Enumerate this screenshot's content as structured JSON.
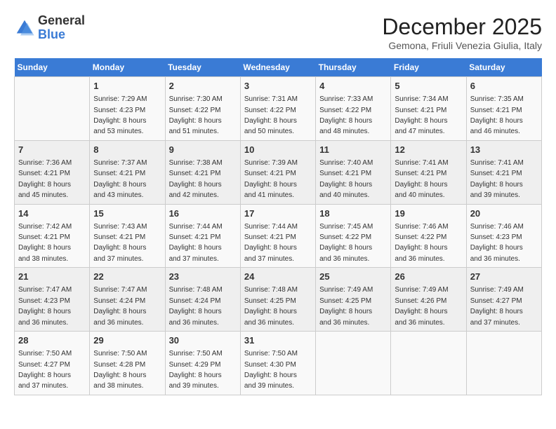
{
  "header": {
    "logo_general": "General",
    "logo_blue": "Blue",
    "month_title": "December 2025",
    "location": "Gemona, Friuli Venezia Giulia, Italy"
  },
  "days_of_week": [
    "Sunday",
    "Monday",
    "Tuesday",
    "Wednesday",
    "Thursday",
    "Friday",
    "Saturday"
  ],
  "weeks": [
    [
      {
        "day": "",
        "info": ""
      },
      {
        "day": "1",
        "info": "Sunrise: 7:29 AM\nSunset: 4:23 PM\nDaylight: 8 hours\nand 53 minutes."
      },
      {
        "day": "2",
        "info": "Sunrise: 7:30 AM\nSunset: 4:22 PM\nDaylight: 8 hours\nand 51 minutes."
      },
      {
        "day": "3",
        "info": "Sunrise: 7:31 AM\nSunset: 4:22 PM\nDaylight: 8 hours\nand 50 minutes."
      },
      {
        "day": "4",
        "info": "Sunrise: 7:33 AM\nSunset: 4:22 PM\nDaylight: 8 hours\nand 48 minutes."
      },
      {
        "day": "5",
        "info": "Sunrise: 7:34 AM\nSunset: 4:21 PM\nDaylight: 8 hours\nand 47 minutes."
      },
      {
        "day": "6",
        "info": "Sunrise: 7:35 AM\nSunset: 4:21 PM\nDaylight: 8 hours\nand 46 minutes."
      }
    ],
    [
      {
        "day": "7",
        "info": "Sunrise: 7:36 AM\nSunset: 4:21 PM\nDaylight: 8 hours\nand 45 minutes."
      },
      {
        "day": "8",
        "info": "Sunrise: 7:37 AM\nSunset: 4:21 PM\nDaylight: 8 hours\nand 43 minutes."
      },
      {
        "day": "9",
        "info": "Sunrise: 7:38 AM\nSunset: 4:21 PM\nDaylight: 8 hours\nand 42 minutes."
      },
      {
        "day": "10",
        "info": "Sunrise: 7:39 AM\nSunset: 4:21 PM\nDaylight: 8 hours\nand 41 minutes."
      },
      {
        "day": "11",
        "info": "Sunrise: 7:40 AM\nSunset: 4:21 PM\nDaylight: 8 hours\nand 40 minutes."
      },
      {
        "day": "12",
        "info": "Sunrise: 7:41 AM\nSunset: 4:21 PM\nDaylight: 8 hours\nand 40 minutes."
      },
      {
        "day": "13",
        "info": "Sunrise: 7:41 AM\nSunset: 4:21 PM\nDaylight: 8 hours\nand 39 minutes."
      }
    ],
    [
      {
        "day": "14",
        "info": "Sunrise: 7:42 AM\nSunset: 4:21 PM\nDaylight: 8 hours\nand 38 minutes."
      },
      {
        "day": "15",
        "info": "Sunrise: 7:43 AM\nSunset: 4:21 PM\nDaylight: 8 hours\nand 37 minutes."
      },
      {
        "day": "16",
        "info": "Sunrise: 7:44 AM\nSunset: 4:21 PM\nDaylight: 8 hours\nand 37 minutes."
      },
      {
        "day": "17",
        "info": "Sunrise: 7:44 AM\nSunset: 4:21 PM\nDaylight: 8 hours\nand 37 minutes."
      },
      {
        "day": "18",
        "info": "Sunrise: 7:45 AM\nSunset: 4:22 PM\nDaylight: 8 hours\nand 36 minutes."
      },
      {
        "day": "19",
        "info": "Sunrise: 7:46 AM\nSunset: 4:22 PM\nDaylight: 8 hours\nand 36 minutes."
      },
      {
        "day": "20",
        "info": "Sunrise: 7:46 AM\nSunset: 4:23 PM\nDaylight: 8 hours\nand 36 minutes."
      }
    ],
    [
      {
        "day": "21",
        "info": "Sunrise: 7:47 AM\nSunset: 4:23 PM\nDaylight: 8 hours\nand 36 minutes."
      },
      {
        "day": "22",
        "info": "Sunrise: 7:47 AM\nSunset: 4:24 PM\nDaylight: 8 hours\nand 36 minutes."
      },
      {
        "day": "23",
        "info": "Sunrise: 7:48 AM\nSunset: 4:24 PM\nDaylight: 8 hours\nand 36 minutes."
      },
      {
        "day": "24",
        "info": "Sunrise: 7:48 AM\nSunset: 4:25 PM\nDaylight: 8 hours\nand 36 minutes."
      },
      {
        "day": "25",
        "info": "Sunrise: 7:49 AM\nSunset: 4:25 PM\nDaylight: 8 hours\nand 36 minutes."
      },
      {
        "day": "26",
        "info": "Sunrise: 7:49 AM\nSunset: 4:26 PM\nDaylight: 8 hours\nand 36 minutes."
      },
      {
        "day": "27",
        "info": "Sunrise: 7:49 AM\nSunset: 4:27 PM\nDaylight: 8 hours\nand 37 minutes."
      }
    ],
    [
      {
        "day": "28",
        "info": "Sunrise: 7:50 AM\nSunset: 4:27 PM\nDaylight: 8 hours\nand 37 minutes."
      },
      {
        "day": "29",
        "info": "Sunrise: 7:50 AM\nSunset: 4:28 PM\nDaylight: 8 hours\nand 38 minutes."
      },
      {
        "day": "30",
        "info": "Sunrise: 7:50 AM\nSunset: 4:29 PM\nDaylight: 8 hours\nand 39 minutes."
      },
      {
        "day": "31",
        "info": "Sunrise: 7:50 AM\nSunset: 4:30 PM\nDaylight: 8 hours\nand 39 minutes."
      },
      {
        "day": "",
        "info": ""
      },
      {
        "day": "",
        "info": ""
      },
      {
        "day": "",
        "info": ""
      }
    ]
  ]
}
